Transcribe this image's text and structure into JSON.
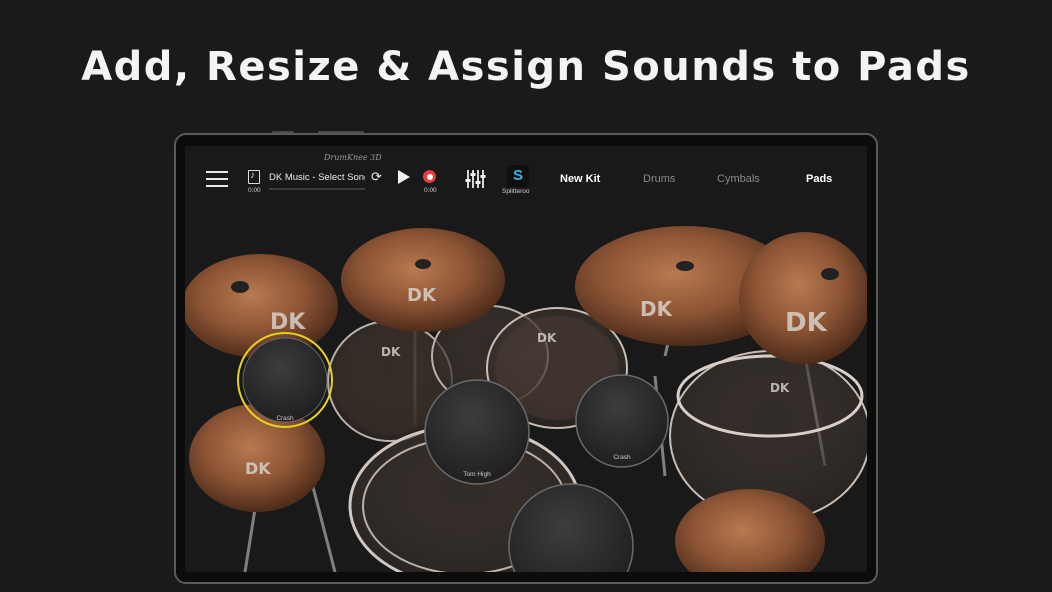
{
  "headline": "Add, Resize & Assign Sounds to Pads",
  "topbar": {
    "brand": "DrumKnee 3D",
    "song_title": "DK Music - Select Song",
    "time_elapsed": "0:00",
    "time_record": "0:00",
    "splitter_label": "Splitteroo",
    "nav": {
      "new_kit": "New Kit",
      "drums": "Drums",
      "cymbals": "Cymbals",
      "pads": "Pads"
    }
  },
  "cymbal_logo": "DK",
  "pads": {
    "crash_left": "Crash",
    "tom_high": "Tom High",
    "crash_right": "Crash"
  },
  "colors": {
    "accent_selected": "#e6d21e",
    "record_red": "#e23c3c",
    "splitter_blue": "#39b3e6"
  }
}
